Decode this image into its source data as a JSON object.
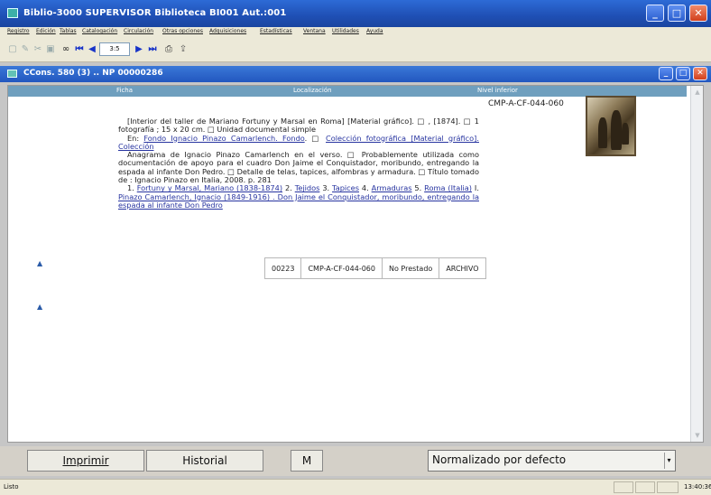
{
  "window": {
    "title": "Biblio-3000 SUPERVISOR  Biblioteca BI001 Aut.:001",
    "minimize": "_",
    "maximize": "□",
    "close": "✕"
  },
  "menu": [
    "Registro",
    "Edición",
    "Tablas",
    "Catalogación",
    "Circulación",
    "Otras opciones",
    "Adquisiciones",
    "Estadísticas",
    "Ventana",
    "Utilidades",
    "Ayuda"
  ],
  "toolbar": {
    "page": "3:5",
    "icons": [
      "new-icon",
      "edit-icon",
      "delete-icon",
      "save-icon",
      "binoculars-icon",
      "first-icon",
      "prev-icon",
      "next-icon",
      "last-icon",
      "print-icon",
      "export-icon"
    ]
  },
  "subwindow": {
    "title": "CCons. 580 (3) .. NP 00000286"
  },
  "columns": {
    "ficha": "Ficha",
    "localizacion": "Localización",
    "nivel": "Nivel inferior"
  },
  "record": {
    "call_number": "CMP-A-CF-044-060",
    "line1": "[Interior del taller de Mariano Fortuny y Marsal en Roma] [Material gráfico]. □ , [1874]. □ 1 fotografía ; 15 x 20 cm. □ Unidad documental simple",
    "en_label": "En:",
    "en_link1": "Fondo Ignacio Pinazo Camarlench. Fondo",
    "en_sep": ". □",
    "en_link2": "Colección fotográfica [Material gráfico]. Colección",
    "note": "Anagrama de Ignacio Pinazo Camarlench en el verso. □ Probablemente utilizada como documentación de apoyo para el cuadro Don Jaime el Conquistador, moribundo, entregando la espada al infante Don Pedro. □ Detalle de telas, tapices, alfombras y armadura. □ Título tomado de : Ignacio Pinazo en Italia, 2008. p. 281",
    "subjects": [
      {
        "num": "1.",
        "text": "Fortuny y Marsal, Mariano (1838-1874)"
      },
      {
        "num": "2.",
        "text": "Tejidos"
      },
      {
        "num": "3.",
        "text": "Tapices"
      },
      {
        "num": "4.",
        "text": "Armaduras"
      },
      {
        "num": "5.",
        "text": "Roma (Italia)"
      },
      {
        "num": "I.",
        "text": "Pinazo Camarlench, Ignacio (1849-1916) . Don Jaime el Conquistador, moribundo, entregando la espada al infante Don Pedro"
      }
    ]
  },
  "items": [
    {
      "number": "00223",
      "signature": "CMP-A-CF-044-060",
      "status": "No Prestado",
      "location": "ARCHIVO"
    }
  ],
  "footer": {
    "print": "Imprimir",
    "history": "Historial",
    "m": "M",
    "format": "Normalizado por defecto"
  },
  "status": {
    "left": "Listo",
    "clock": "13:40:36"
  }
}
